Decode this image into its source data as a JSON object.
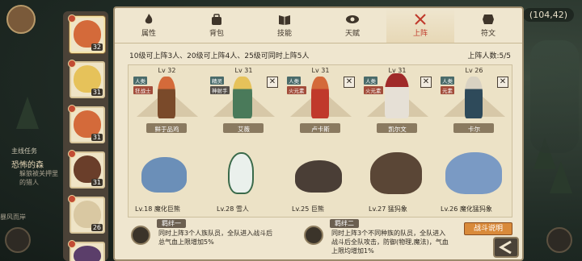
{
  "hud": {
    "coords": "(104,42)",
    "quest_title": "主线任务",
    "quest_name": "恐怖的森",
    "quest_desc": "躲狼被关押里的猎人",
    "bottom_text": "暴风而岸"
  },
  "hero_list": [
    {
      "level": "32",
      "face": "#d46a3a"
    },
    {
      "level": "31",
      "face": "#e6c25a"
    },
    {
      "level": "31",
      "face": "#d46a3a"
    },
    {
      "level": "31",
      "face": "#6a3e2a"
    },
    {
      "level": "26",
      "face": "#d9c8a2"
    },
    {
      "level": "",
      "face": "#5b3e6a"
    }
  ],
  "tabs": [
    {
      "label": "属性",
      "icon": "flame-icon",
      "active": false
    },
    {
      "label": "背包",
      "icon": "bag-icon",
      "active": false
    },
    {
      "label": "技能",
      "icon": "book-icon",
      "active": false
    },
    {
      "label": "天赋",
      "icon": "eye-icon",
      "active": false
    },
    {
      "label": "上阵",
      "icon": "crossed-swords-icon",
      "active": true
    },
    {
      "label": "符文",
      "icon": "rune-icon",
      "active": false
    }
  ],
  "info_left": "10级可上阵3人、20级可上阵4人、25级可同时上阵5人",
  "info_right": "上阵人数:5/5",
  "slots": [
    {
      "level": "Lv 32",
      "name": "鲜于品鸡",
      "tags": [
        "人类",
        "狂战士"
      ]
    },
    {
      "level": "Lv 31",
      "name": "艾薇",
      "tags": [
        "精灵",
        "神射手"
      ]
    },
    {
      "level": "Lv 31",
      "name": "卢卡斯",
      "tags": [
        "人类",
        "火元素"
      ]
    },
    {
      "level": "Lv 31",
      "name": "凯尔文",
      "tags": [
        "人类",
        "火元素"
      ]
    },
    {
      "level": "Lv 26",
      "name": "卡尔",
      "tags": [
        "人类",
        "元素"
      ]
    }
  ],
  "pets": [
    {
      "label": "Lv.18 魔化巨熊"
    },
    {
      "label": "Lv.28 雪人"
    },
    {
      "label": "Lv.25 巨熊"
    },
    {
      "label": "Lv.27 猛犸象"
    },
    {
      "label": "Lv.26 魔化猛犸象"
    }
  ],
  "bonds": [
    {
      "title": "羁绊一",
      "line1": "同时上阵3个人族队员，全队进入战斗后",
      "line2": "总气血上限增加5%"
    },
    {
      "title": "羁绊二",
      "line1": "同时上阵3个不同种族的队员，全队进入",
      "line2": "战斗后全队攻击，防御(物理,魔法)，气血",
      "line3": "上限均增加1%"
    }
  ],
  "battle_button": "战斗说明",
  "colors": {
    "accent": "#c0392b",
    "panel": "#efe6cf",
    "button": "#d98a3a"
  }
}
